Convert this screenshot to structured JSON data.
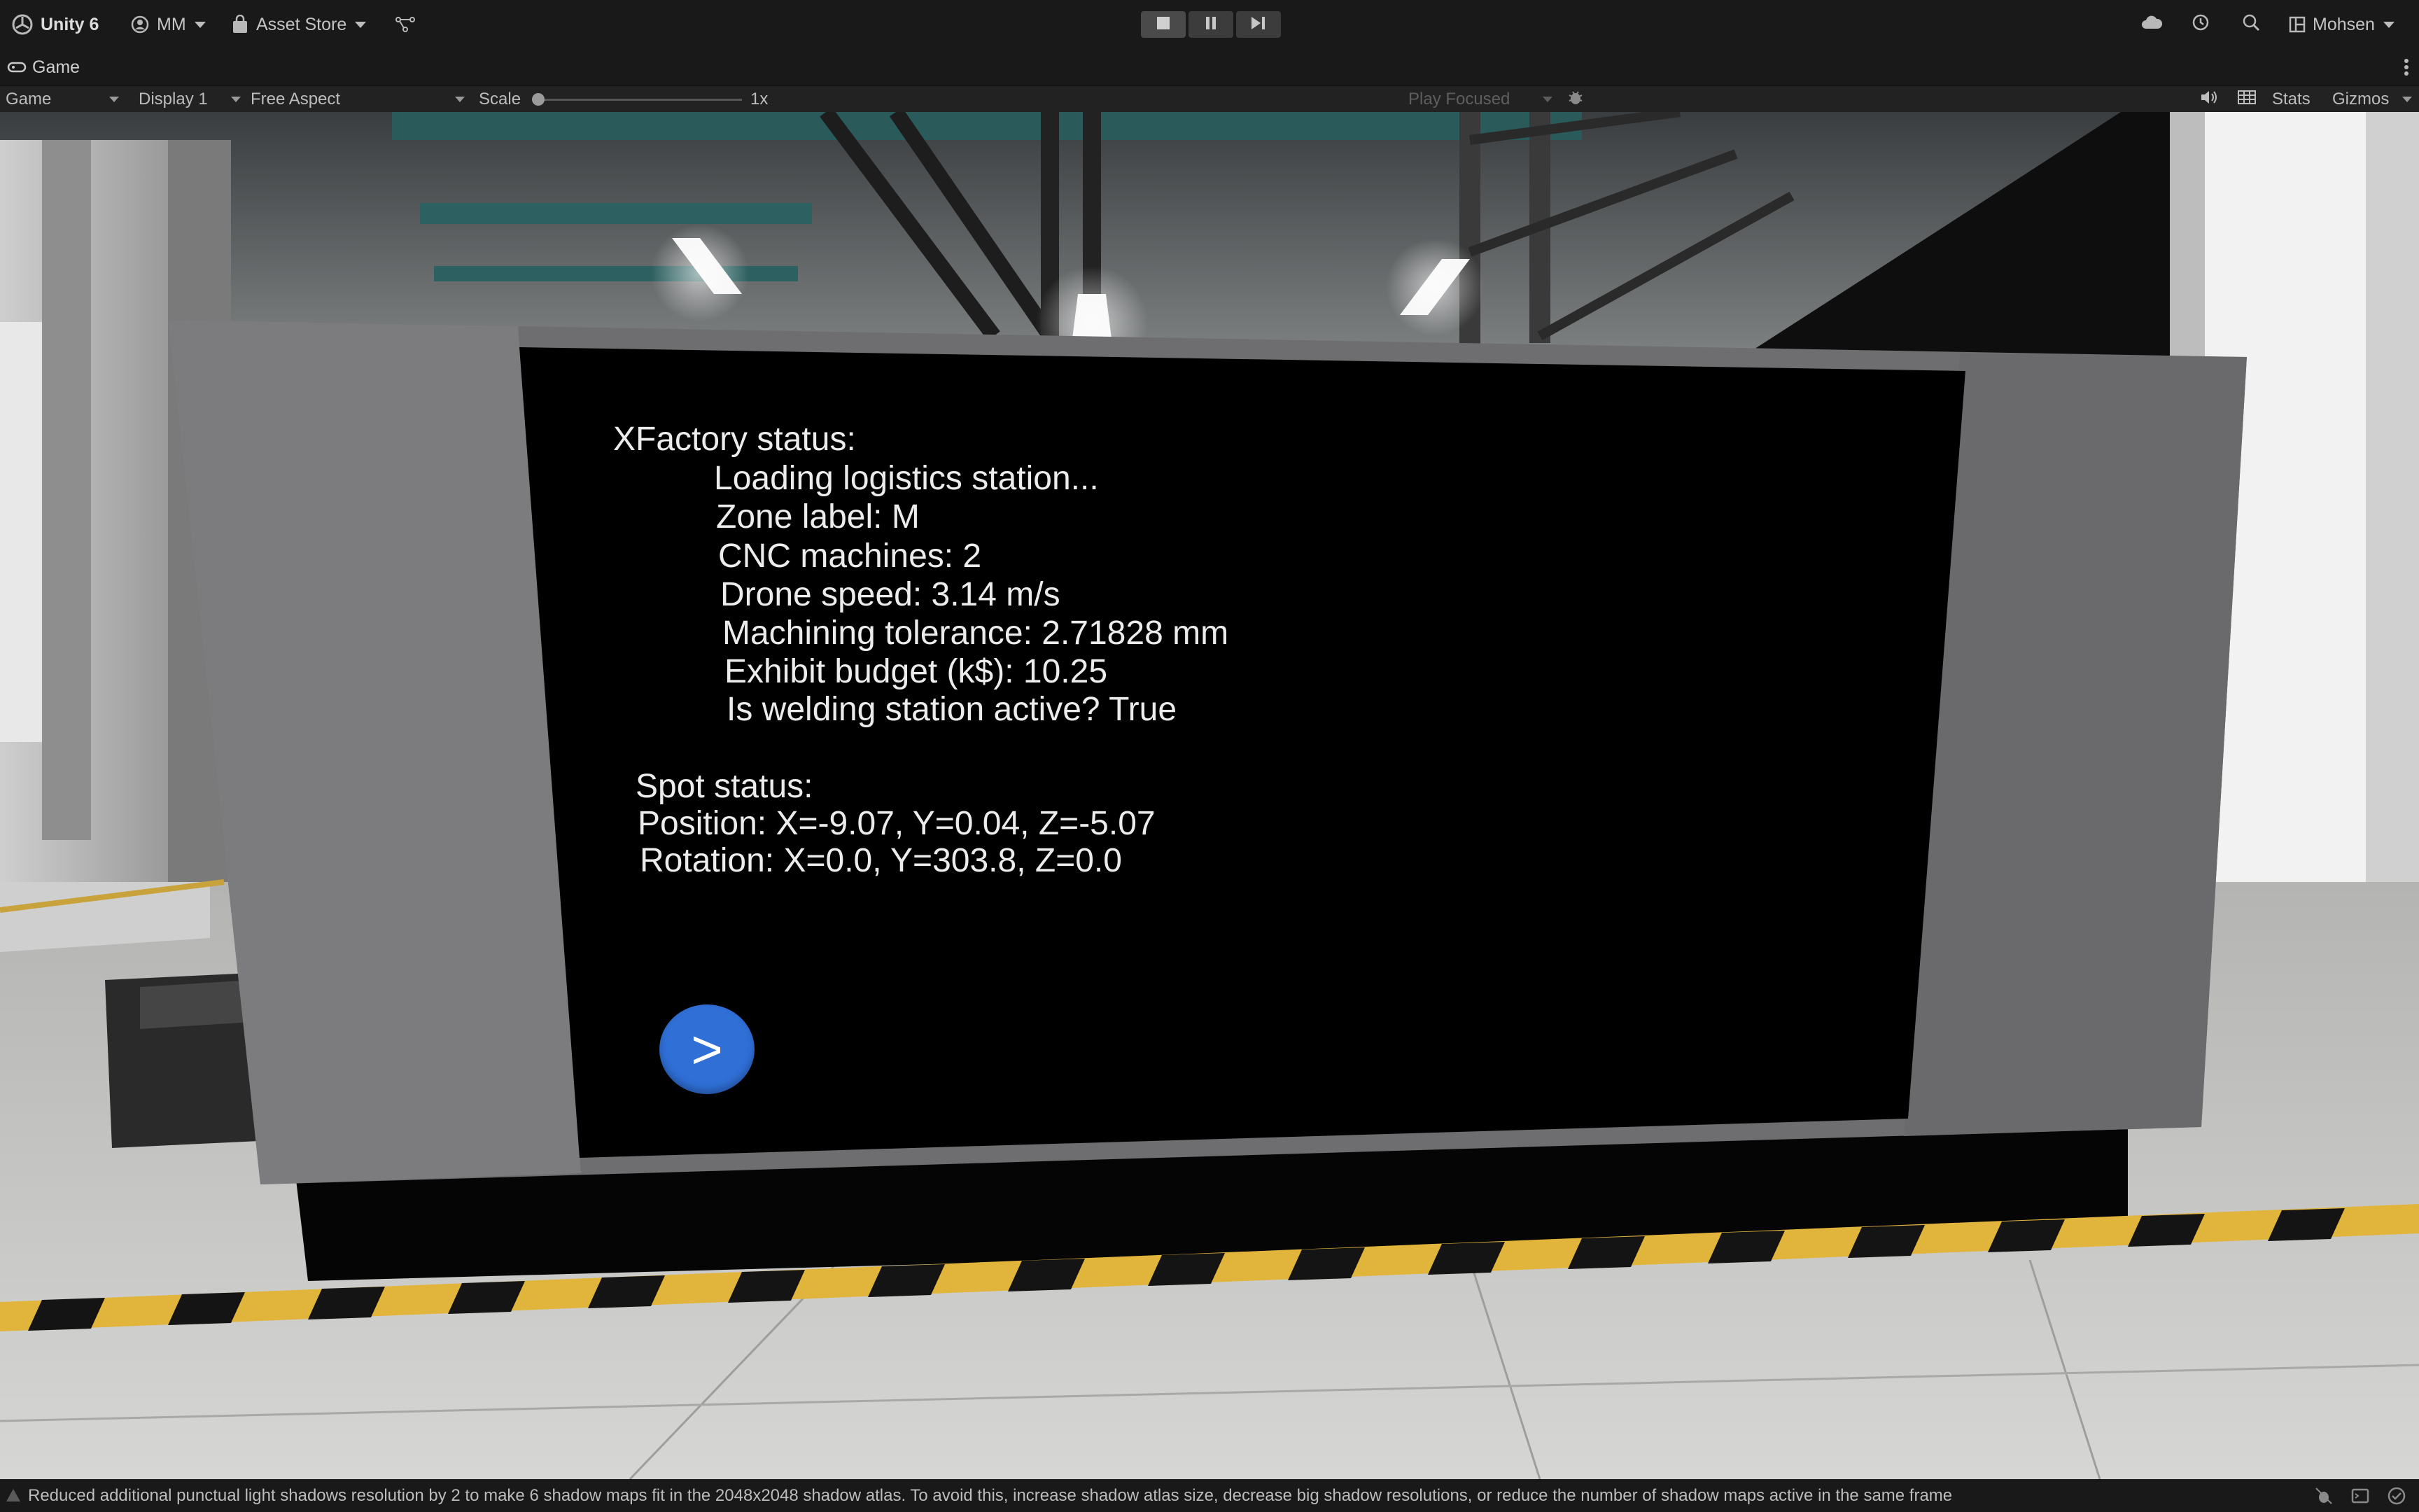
{
  "toolbar": {
    "app_name": "Unity 6",
    "account": "MM",
    "asset_store": "Asset Store",
    "user": "Mohsen",
    "icons": [
      "unity-logo-icon",
      "account-icon",
      "asset-store-icon",
      "version-control-icon",
      "play-icon",
      "pause-icon",
      "step-icon",
      "cloud-icon",
      "history-icon",
      "search-icon",
      "layout-icon"
    ]
  },
  "tab": {
    "label": "Game"
  },
  "gamebar": {
    "view_mode": "Game",
    "display": "Display 1",
    "aspect": "Free Aspect",
    "scale_label": "Scale",
    "scale_value": "1x",
    "scale_level": 0,
    "play_mode": "Play Focused",
    "stats": "Stats",
    "gizmos": "Gizmos"
  },
  "screen": {
    "title": "XFactory status:",
    "lines": [
      "Loading logistics station...",
      "Zone label: M",
      "CNC machines: 2",
      "Drone speed: 3.14 m/s",
      "Machining tolerance: 2.71828 mm",
      "Exhibit budget (k$): 10.25",
      "Is welding station active? True"
    ],
    "spot_title": "Spot status:",
    "position": "Position: X=-9.07, Y=0.04, Z=-5.07",
    "rotation": "Rotation: X=0.0, Y=303.8, Z=0.0",
    "next_label": ">"
  },
  "statusbar": {
    "message": "Reduced additional punctual light shadows resolution by 2 to make 6 shadow maps fit in the 2048x2048 shadow atlas. To avoid this, increase shadow atlas size, decrease big shadow resolutions, or reduce the number of shadow maps active in the same frame"
  },
  "colors": {
    "accent_button": "#2f6fd6",
    "hazard_yellow": "#e1b43c",
    "editor_bg": "#191919"
  }
}
